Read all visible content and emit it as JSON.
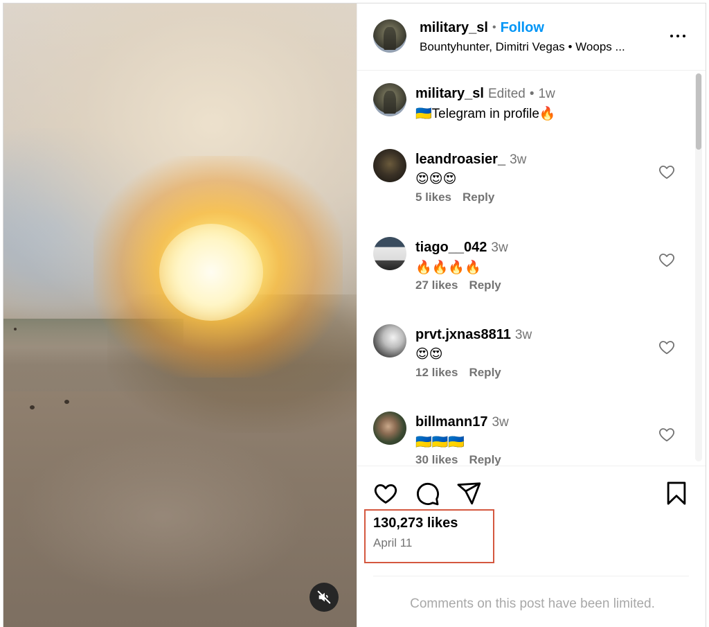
{
  "media": {
    "mute_icon": "speaker-muted-icon"
  },
  "header": {
    "username": "military_sl",
    "separator": "•",
    "follow_label": "Follow",
    "audio": "Bountyhunter, Dimitri Vegas • Woops ...",
    "more_icon": "more-horizontal-icon"
  },
  "caption": {
    "username": "military_sl",
    "edited": "Edited",
    "separator": "•",
    "time": "1w",
    "text": "🇺🇦Telegram in profile🔥"
  },
  "comments": [
    {
      "username": "leandroasier_",
      "time": "3w",
      "text": "😍😍😍",
      "likes": "5 likes",
      "reply": "Reply"
    },
    {
      "username": "tiago__042",
      "time": "3w",
      "text": "🔥🔥🔥🔥",
      "likes": "27 likes",
      "reply": "Reply"
    },
    {
      "username": "prvt.jxnas8811",
      "time": "3w",
      "text": "😍😍",
      "likes": "12 likes",
      "reply": "Reply"
    },
    {
      "username": "billmann17",
      "time": "3w",
      "text": "🇺🇦🇺🇦🇺🇦",
      "likes": "30 likes",
      "reply": "Reply"
    }
  ],
  "footer": {
    "likes": "130,273 likes",
    "date": "April 11",
    "limited_notice": "Comments on this post have been limited.",
    "icons": [
      "heart-icon",
      "comment-icon",
      "share-icon",
      "bookmark-icon"
    ]
  },
  "colors": {
    "follow_blue": "#0095f6",
    "secondary_text": "#737373",
    "highlight_box": "#d4573f"
  }
}
